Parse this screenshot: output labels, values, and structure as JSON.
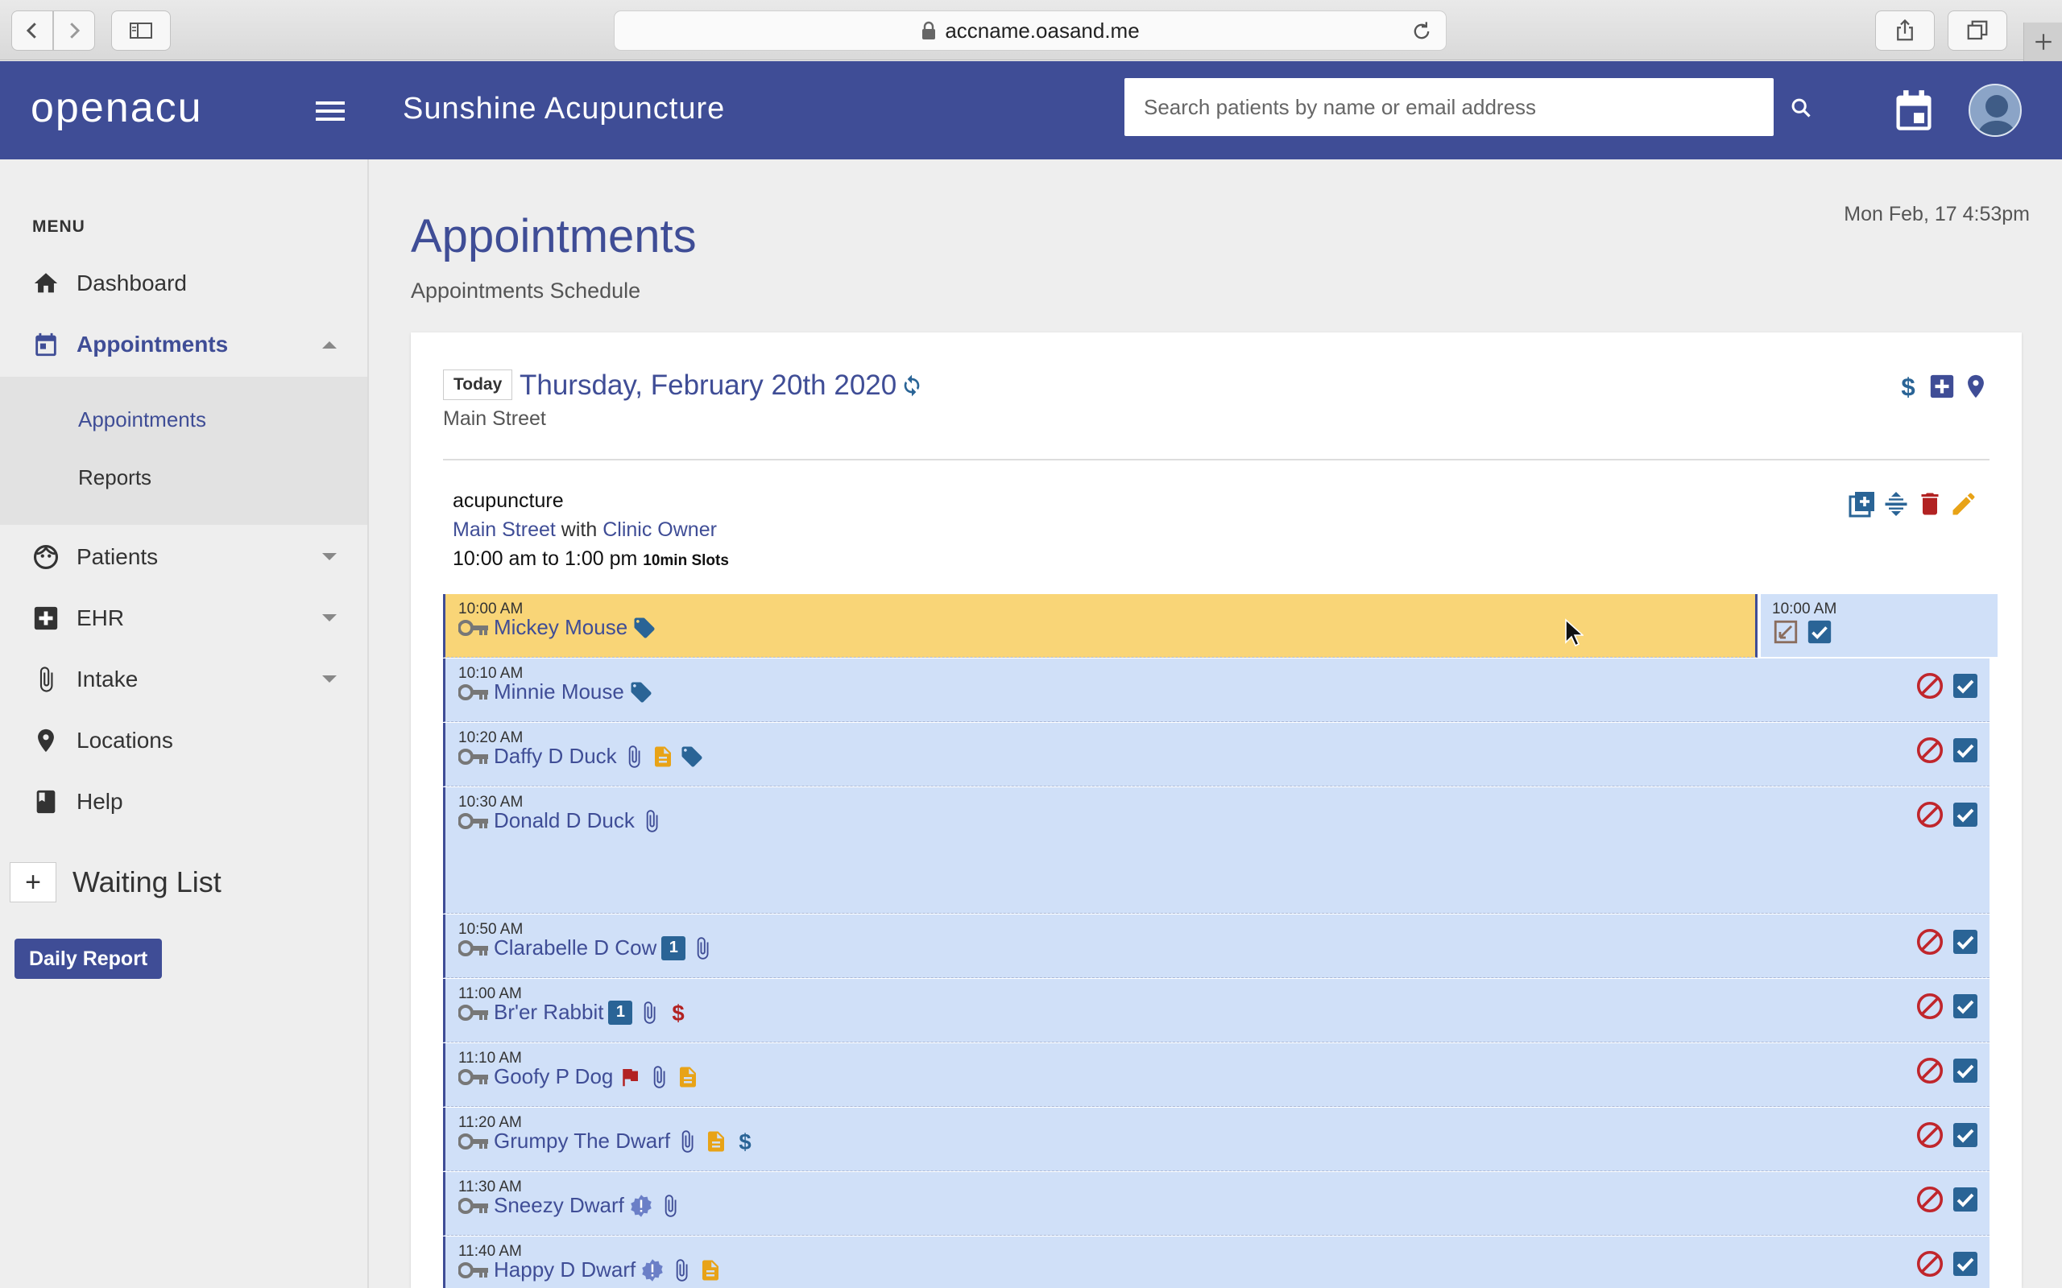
{
  "browser": {
    "url": "accname.oasand.me"
  },
  "header": {
    "logo_light": "open",
    "logo_bold": "acu",
    "clinic_name": "Sunshine Acupuncture",
    "search_placeholder": "Search patients by name or email address",
    "brand_color": "#3f4d96"
  },
  "sidebar": {
    "menu_label": "MENU",
    "items": [
      {
        "label": "Dashboard",
        "icon": "home-icon"
      },
      {
        "label": "Appointments",
        "icon": "calendar-icon",
        "expanded": true
      },
      {
        "label": "Patients",
        "icon": "face-icon"
      },
      {
        "label": "EHR",
        "icon": "medical-plus-icon"
      },
      {
        "label": "Intake",
        "icon": "paperclip-icon"
      },
      {
        "label": "Locations",
        "icon": "map-pin-icon"
      },
      {
        "label": "Help",
        "icon": "book-icon"
      }
    ],
    "subitems": [
      "Appointments",
      "Reports"
    ],
    "waiting_plus": "+",
    "waiting_label": "Waiting List",
    "daily_report": "Daily Report"
  },
  "main": {
    "title": "Appointments",
    "subtitle": "Appointments Schedule",
    "now": "Mon Feb, 17 4:53pm",
    "today_button": "Today",
    "date": "Thursday, February 20th 2020",
    "location": "Main Street",
    "block": {
      "name": "acupuncture",
      "location": "Main Street",
      "with": "with",
      "practitioner": "Clinic Owner",
      "hours": "10:00 am to 1:00 pm",
      "slot_size": "10min Slots"
    },
    "side_slot_time": "10:00 AM",
    "appointments": [
      {
        "time": "10:00 AM",
        "name": "Mickey Mouse",
        "icons": [
          "tag-icon"
        ],
        "highlighted": true
      },
      {
        "time": "10:10 AM",
        "name": "Minnie Mouse",
        "icons": [
          "tag-icon"
        ]
      },
      {
        "time": "10:20 AM",
        "name": "Daffy D Duck",
        "icons": [
          "paperclip-icon",
          "note-icon",
          "tag-icon"
        ]
      },
      {
        "time": "10:30 AM",
        "name": "Donald D Duck",
        "icons": [
          "paperclip-icon"
        ],
        "tall": true
      },
      {
        "time": "10:50 AM",
        "name": "Clarabelle D Cow",
        "icons": [
          "badge-1",
          "paperclip-icon"
        ]
      },
      {
        "time": "11:00 AM",
        "name": "Br'er Rabbit",
        "icons": [
          "badge-1",
          "paperclip-icon",
          "dollar-red-icon"
        ]
      },
      {
        "time": "11:10 AM",
        "name": "Goofy P Dog",
        "icons": [
          "flag-icon",
          "paperclip-icon",
          "note-icon"
        ]
      },
      {
        "time": "11:20 AM",
        "name": "Grumpy The Dwarf",
        "icons": [
          "paperclip-icon",
          "note-icon",
          "dollar-blue-icon"
        ]
      },
      {
        "time": "11:30 AM",
        "name": "Sneezy Dwarf",
        "icons": [
          "alert-badge-icon",
          "paperclip-icon"
        ]
      },
      {
        "time": "11:40 AM",
        "name": "Happy D Dwarf",
        "icons": [
          "alert-badge-icon",
          "paperclip-icon",
          "note-icon"
        ]
      }
    ],
    "badge_text": "1"
  }
}
